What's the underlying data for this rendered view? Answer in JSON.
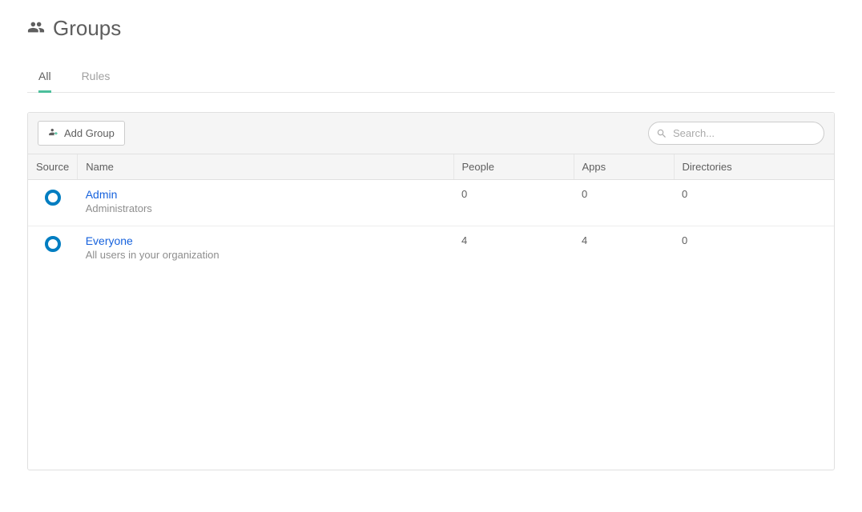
{
  "header": {
    "title": "Groups"
  },
  "tabs": [
    {
      "label": "All",
      "active": true
    },
    {
      "label": "Rules",
      "active": false
    }
  ],
  "toolbar": {
    "add_group_label": "Add Group",
    "search_placeholder": "Search..."
  },
  "table": {
    "columns": {
      "source": "Source",
      "name": "Name",
      "people": "People",
      "apps": "Apps",
      "directories": "Directories"
    },
    "rows": [
      {
        "name": "Admin",
        "description": "Administrators",
        "people": "0",
        "apps": "0",
        "directories": "0"
      },
      {
        "name": "Everyone",
        "description": "All users in your organization",
        "people": "4",
        "apps": "4",
        "directories": "0"
      }
    ]
  }
}
